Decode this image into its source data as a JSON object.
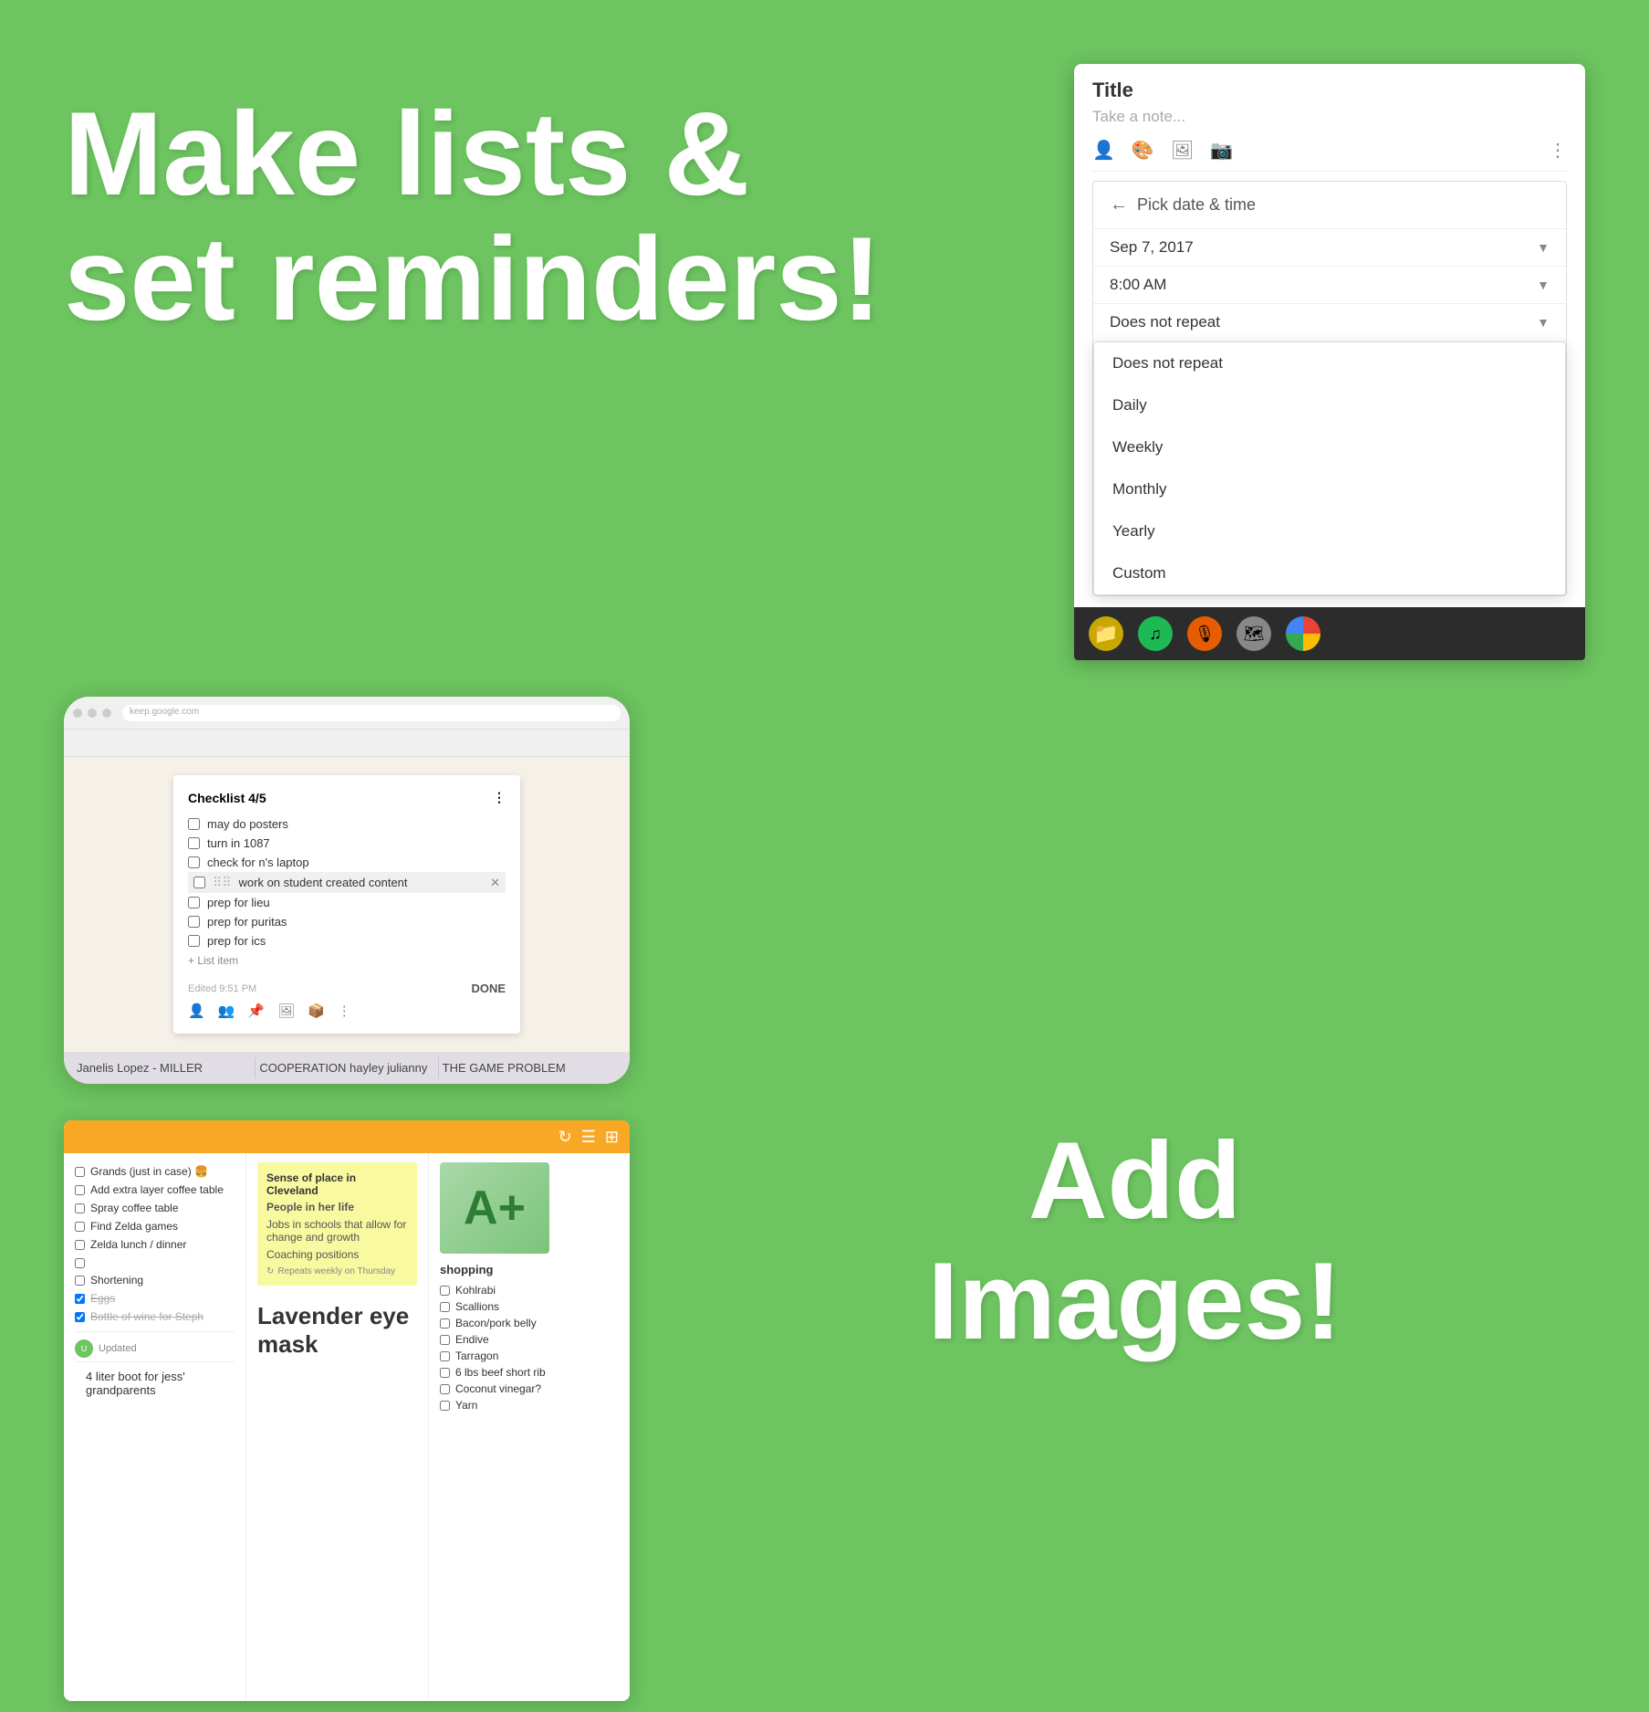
{
  "background_color": "#6dc460",
  "headline": {
    "line1": "Make lists &",
    "line2": "set reminders!"
  },
  "add_images": {
    "line1": "Add",
    "line2": "Images!"
  },
  "keep_card": {
    "title_placeholder": "Title",
    "note_placeholder": "Take a note...",
    "icons": [
      "person-add-icon",
      "palette-icon",
      "image-icon",
      "archive-icon",
      "more-icon"
    ],
    "pick_datetime": {
      "header": "Pick date & time",
      "date_value": "Sep 7, 2017",
      "time_value": "8:00 AM",
      "repeat_value": "Does not repeat"
    },
    "repeat_options": [
      "Does not repeat",
      "Daily",
      "Weekly",
      "Monthly",
      "Yearly",
      "Custom"
    ],
    "taskbar_icons": [
      "folder-icon",
      "spotify-icon",
      "podcast-icon",
      "map-icon",
      "chrome-icon"
    ]
  },
  "checklist_card": {
    "header": "Checklist 4/5",
    "items": [
      {
        "text": "may do posters",
        "checked": false
      },
      {
        "text": "turn in 1087",
        "checked": false
      },
      {
        "text": "check for n's laptop",
        "checked": false
      },
      {
        "text": "work on student created content",
        "checked": false,
        "highlighted": true
      },
      {
        "text": "prep for lieu",
        "checked": false
      },
      {
        "text": "prep for puritas",
        "checked": false
      },
      {
        "text": "prep for ics",
        "checked": false
      }
    ],
    "add_label": "+ List item",
    "footer_text": "Edited 9:51 PM",
    "done_label": "DONE"
  },
  "class_table": {
    "rows": [
      [
        "Janelis Lopez - MILLER",
        "COOPERATION hayley julianny",
        "THE GAME PROBLEM"
      ]
    ]
  },
  "notes_app": {
    "top_bar_icons": [
      "refresh-icon",
      "list-icon",
      "grid-icon"
    ],
    "left_panel": {
      "items": [
        {
          "text": "Grands (just in case) 🍔",
          "checked": false
        },
        {
          "text": "Add extra layer coffee table",
          "checked": false
        },
        {
          "text": "Spray coffee table",
          "checked": false
        },
        {
          "text": "Find Zelda games",
          "checked": false
        },
        {
          "text": "Zelda lunch / dinner",
          "checked": false
        },
        {
          "text": "",
          "checked": false
        },
        {
          "text": "Shortening",
          "checked": false
        },
        {
          "text": "Eggs",
          "checked": true
        },
        {
          "text": "Bottle of wine for Steph",
          "checked": true
        }
      ],
      "updated_label": "Updated"
    },
    "middle_panel": {
      "title": "Sense of place in Cleveland",
      "note_lines": [
        "People in her life",
        "Jobs in schools that allow for change and growth",
        "Coaching positions"
      ],
      "repeat_badge": "Repeats weekly on Thursday",
      "lavender_text": "Lavender eye mask"
    },
    "right_panel": {
      "grade": "A+",
      "shopping_title": "shopping",
      "shopping_items": [
        {
          "text": "Kohlrabi",
          "checked": false
        },
        {
          "text": "Scallions",
          "checked": false
        },
        {
          "text": "Bacon/pork belly",
          "checked": false
        },
        {
          "text": "Endive",
          "checked": false
        },
        {
          "text": "Tarragon",
          "checked": false
        },
        {
          "text": "6 lbs beef short rib",
          "checked": false
        },
        {
          "text": "Coconut vinegar?",
          "checked": false
        },
        {
          "text": "Yarn",
          "checked": false
        }
      ]
    },
    "bottom_note": "4 liter boot for jess' grandparents"
  }
}
